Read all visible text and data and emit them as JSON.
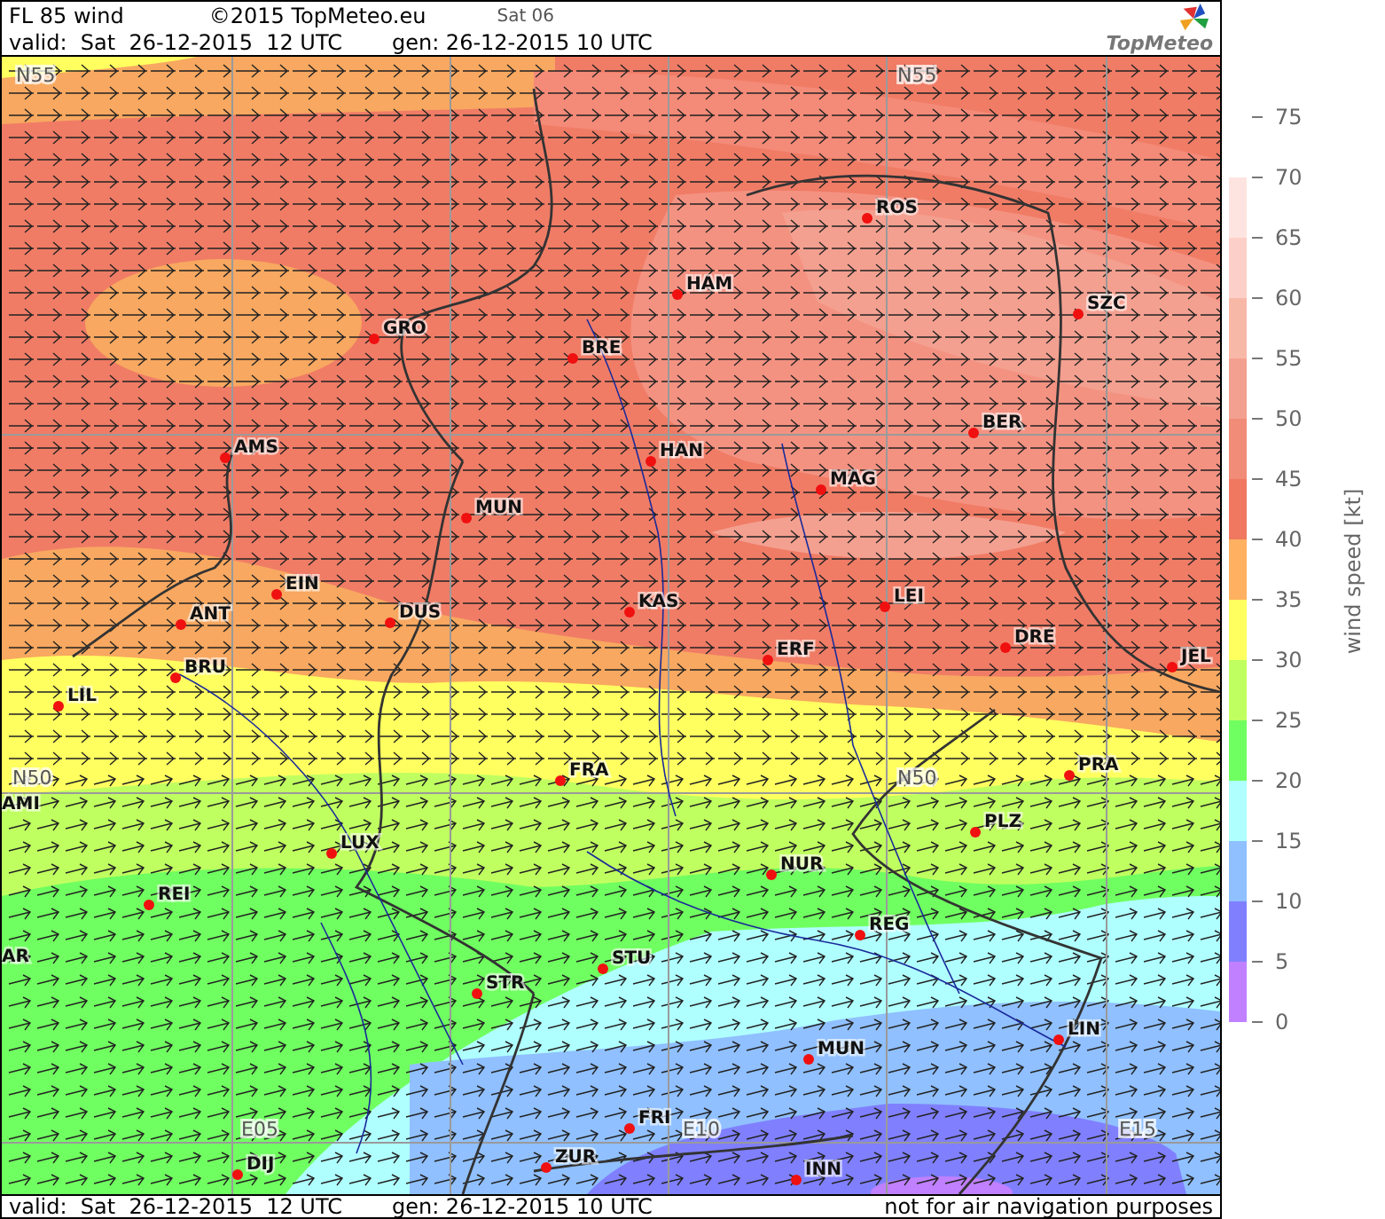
{
  "header": {
    "title": "FL 85 wind",
    "copyright": "©2015 TopMeteo.eu",
    "step": "Sat 06",
    "valid": "valid:  Sat  26-12-2015  12 UTC",
    "generated": "gen: 26-12-2015 10 UTC",
    "logo_text": "TopMeteo"
  },
  "map": {
    "grid_labels": [
      "N55",
      "N55",
      "N50",
      "N50",
      "E05",
      "E10",
      "E15"
    ],
    "cities": [
      {
        "name": "ROS"
      },
      {
        "name": "SZC"
      },
      {
        "name": "HAM"
      },
      {
        "name": "GRO"
      },
      {
        "name": "BRE"
      },
      {
        "name": "BER"
      },
      {
        "name": "AMS"
      },
      {
        "name": "HAN"
      },
      {
        "name": "MAG"
      },
      {
        "name": "MUN"
      },
      {
        "name": "EIN"
      },
      {
        "name": "KAS"
      },
      {
        "name": "LEI"
      },
      {
        "name": "ANT"
      },
      {
        "name": "DUS"
      },
      {
        "name": "DRE"
      },
      {
        "name": "ERF"
      },
      {
        "name": "JEL"
      },
      {
        "name": "BRU"
      },
      {
        "name": "LIL"
      },
      {
        "name": "FRA"
      },
      {
        "name": "PRA"
      },
      {
        "name": "AMI"
      },
      {
        "name": "PLZ"
      },
      {
        "name": "LUX"
      },
      {
        "name": "NUR"
      },
      {
        "name": "REI"
      },
      {
        "name": "REG"
      },
      {
        "name": "AR"
      },
      {
        "name": "STU"
      },
      {
        "name": "STR"
      },
      {
        "name": "LIN"
      },
      {
        "name": "MUN"
      },
      {
        "name": "FRI"
      },
      {
        "name": "ZUR"
      },
      {
        "name": "DIJ"
      },
      {
        "name": "INN"
      }
    ]
  },
  "legend": {
    "title": "wind speed [kt]",
    "ticks": [
      "75",
      "70",
      "65",
      "60",
      "55",
      "50",
      "45",
      "40",
      "35",
      "30",
      "25",
      "20",
      "15",
      "10",
      "5",
      "0"
    ],
    "bins": [
      {
        "color": "#fee4e0"
      },
      {
        "color": "#fcd0c8"
      },
      {
        "color": "#f8b8a8"
      },
      {
        "color": "#f4a090"
      },
      {
        "color": "#f08c78"
      },
      {
        "color": "#f07860"
      },
      {
        "color": "#ffb060"
      },
      {
        "color": "#ffff60"
      },
      {
        "color": "#c0ff60"
      },
      {
        "color": "#70ff60"
      },
      {
        "color": "#b0ffff"
      },
      {
        "color": "#90c0ff"
      },
      {
        "color": "#8080ff"
      },
      {
        "color": "#c080ff"
      }
    ]
  },
  "footer": {
    "valid": "valid:  Sat  26-12-2015  12 UTC",
    "generated": "gen: 26-12-2015 10 UTC",
    "disclaimer": "not for air navigation purposes"
  }
}
